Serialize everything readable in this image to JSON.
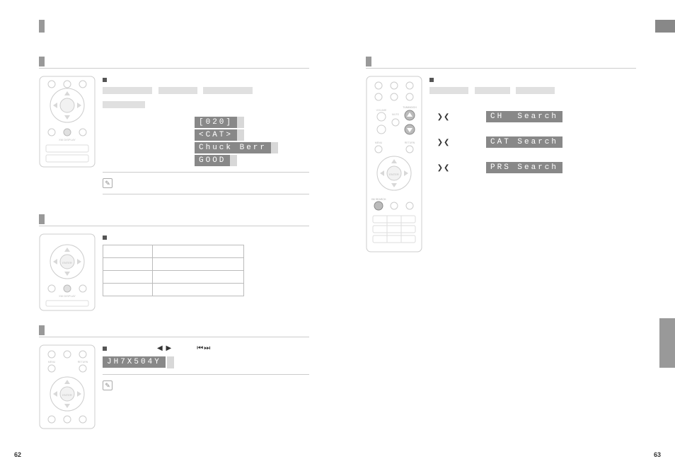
{
  "page_left_num": "62",
  "page_right_num": "63",
  "left": {
    "section1": {
      "display": [
        "[020]",
        "<CAT>",
        "Chuck Berr",
        "GOOD"
      ]
    },
    "section3": {
      "arrows1": "◀ ▶",
      "arrows2": "⏮⏭",
      "display": "JH7X504Y"
    },
    "table_rows": 4
  },
  "right": {
    "search": [
      {
        "arrows": "❯❮",
        "label": "CH  Search"
      },
      {
        "arrows": "❯❮",
        "label": "CAT Search"
      },
      {
        "arrows": "❯❮",
        "label": "PRS Search"
      }
    ]
  },
  "icons": {
    "note": "✎",
    "up": "⌃",
    "down": "⌄"
  }
}
